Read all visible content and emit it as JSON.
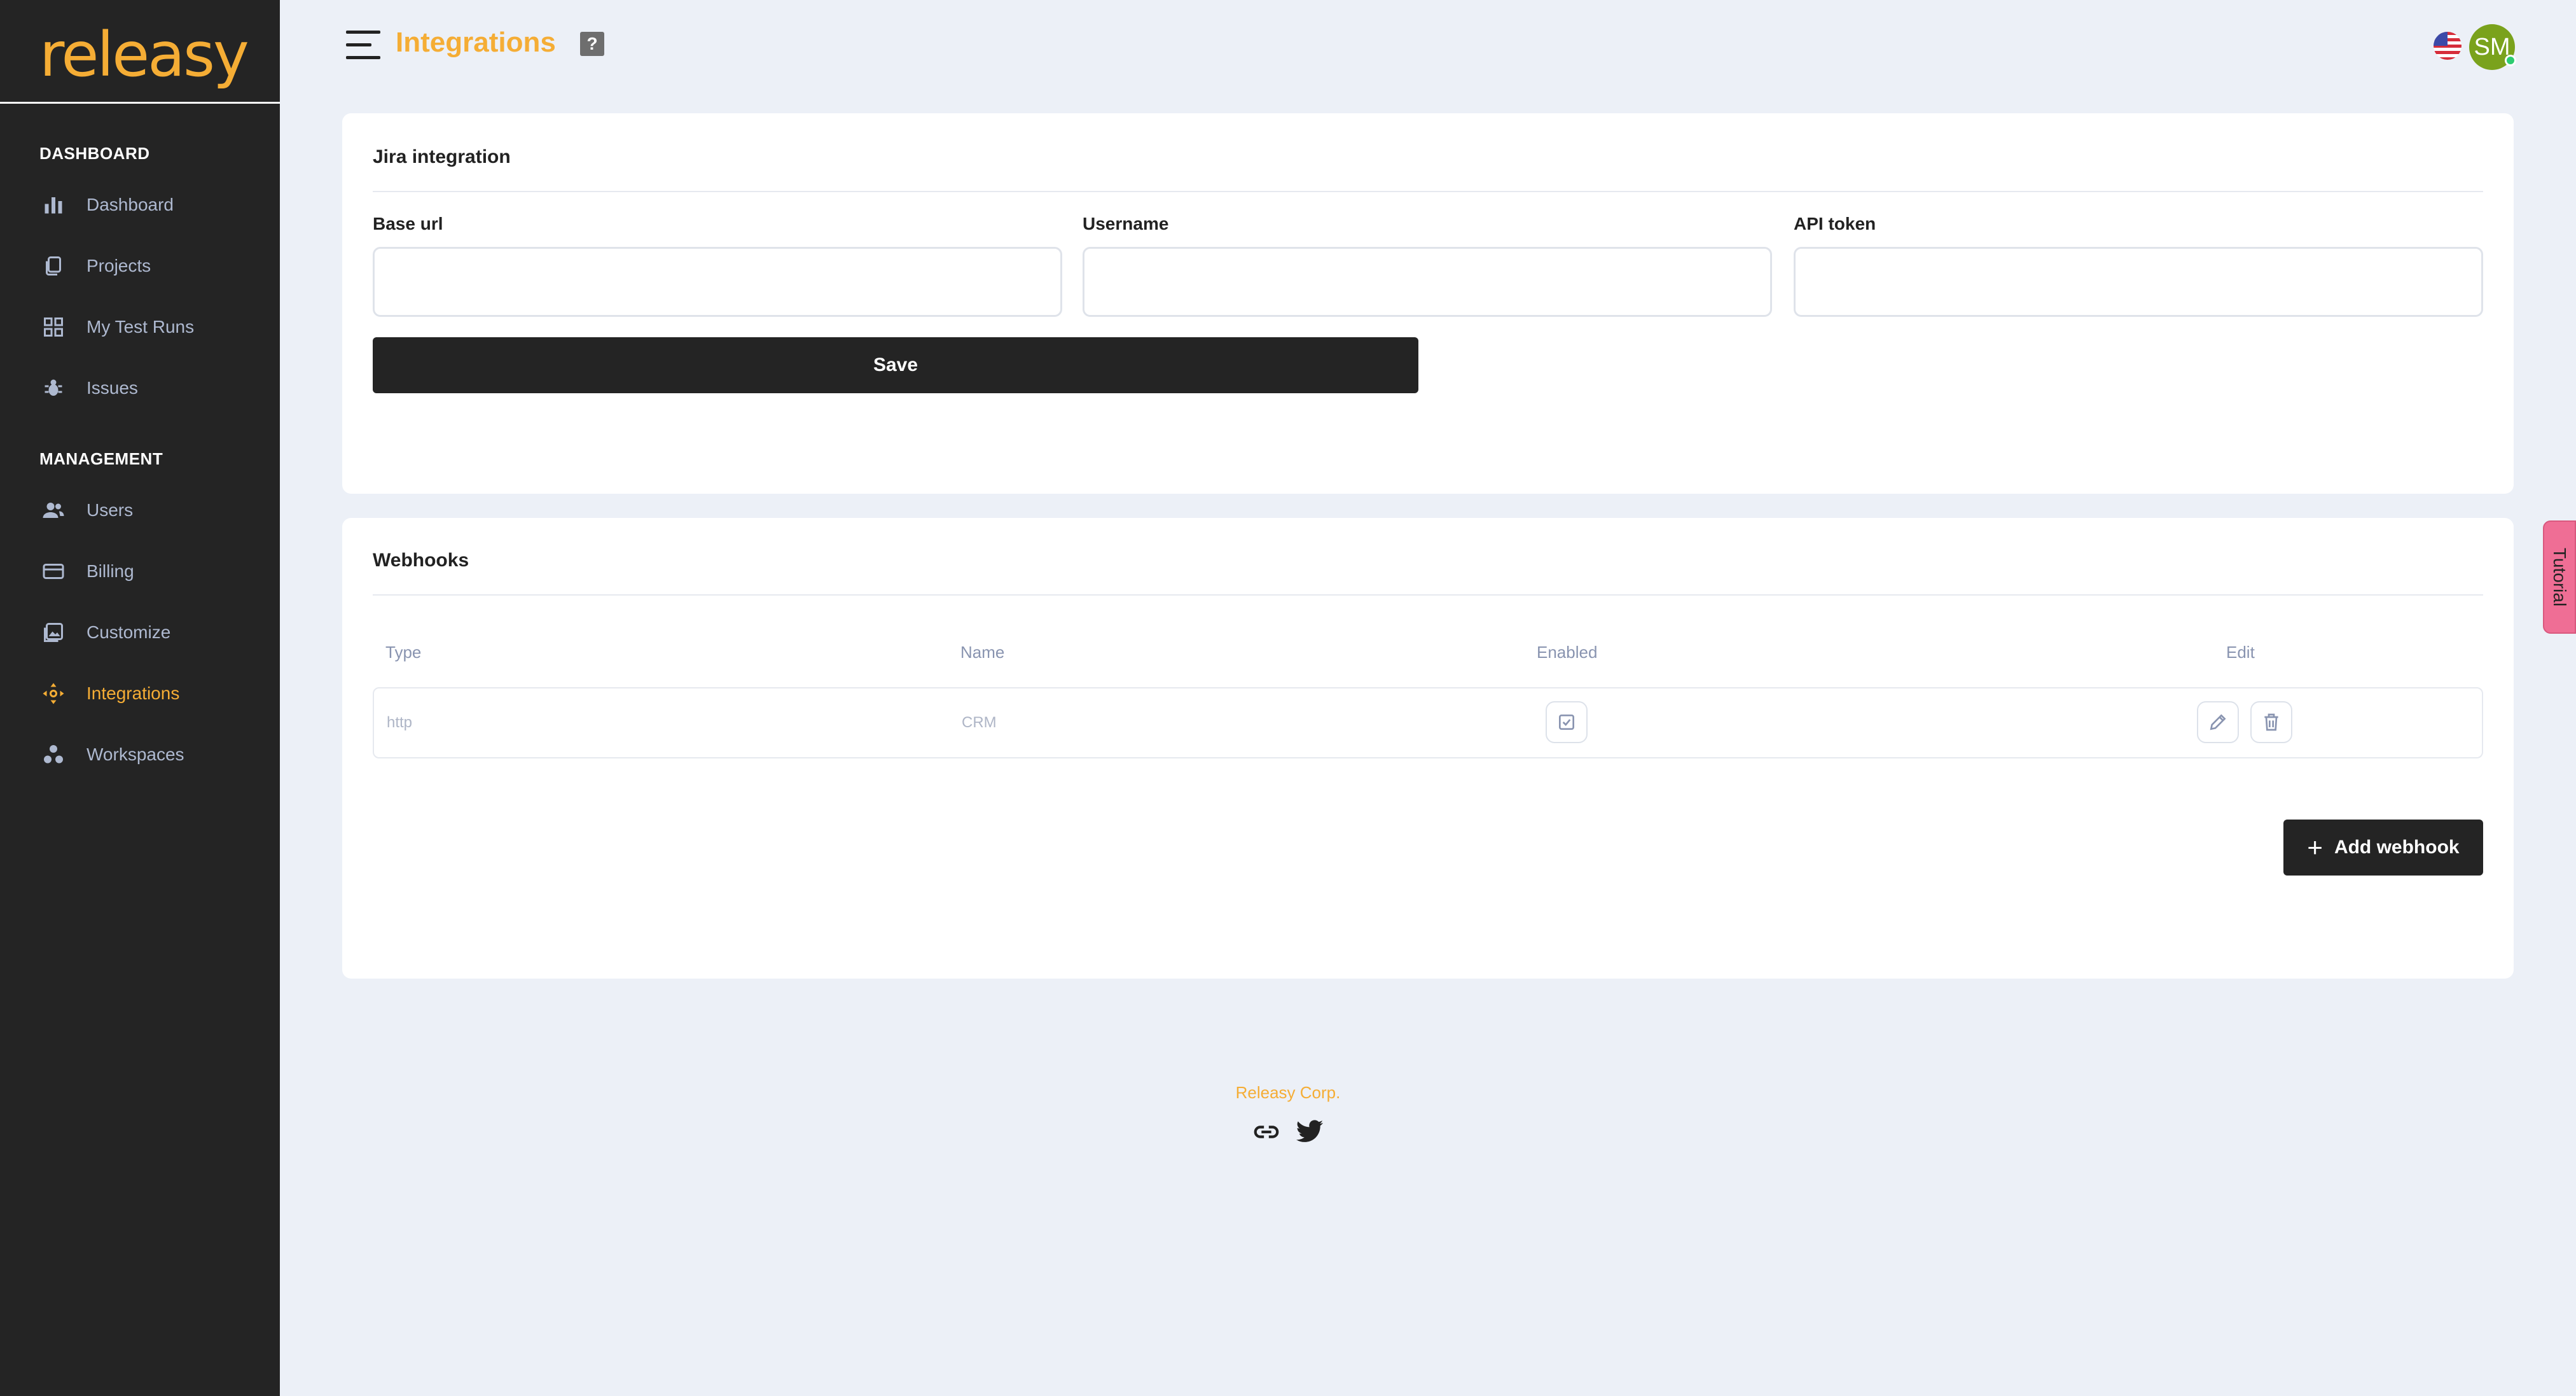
{
  "brand": {
    "logo_text": "releasy",
    "accent": "#f5ad35"
  },
  "sidebar": {
    "sections": [
      {
        "title": "DASHBOARD"
      },
      {
        "title": "MANAGEMENT"
      }
    ],
    "items": [
      {
        "label": "Dashboard",
        "icon": "bar-chart-icon"
      },
      {
        "label": "Projects",
        "icon": "document-copy-icon"
      },
      {
        "label": "My Test Runs",
        "icon": "grid-icon"
      },
      {
        "label": "Issues",
        "icon": "bug-icon"
      },
      {
        "label": "Users",
        "icon": "users-icon"
      },
      {
        "label": "Billing",
        "icon": "credit-card-icon"
      },
      {
        "label": "Customize",
        "icon": "image-gallery-icon"
      },
      {
        "label": "Integrations",
        "icon": "integrations-icon",
        "active": true
      },
      {
        "label": "Workspaces",
        "icon": "workspaces-icon"
      }
    ]
  },
  "header": {
    "title": "Integrations",
    "help_label": "?",
    "avatar_initials": "SM",
    "flag_icon": "us-flag-icon"
  },
  "jira": {
    "title": "Jira integration",
    "fields": [
      {
        "label": "Base url",
        "value": "",
        "placeholder": ""
      },
      {
        "label": "Username",
        "value": "",
        "placeholder": ""
      },
      {
        "label": "API token",
        "value": "",
        "placeholder": ""
      }
    ],
    "save_label": "Save"
  },
  "webhooks": {
    "title": "Webhooks",
    "columns": [
      "Type",
      "Name",
      "Enabled",
      "Edit"
    ],
    "rows": [
      {
        "type": "http",
        "name": "CRM",
        "enabled": true
      }
    ],
    "add_label": "Add webhook"
  },
  "footer": {
    "company": "Releasy Corp.",
    "icons": [
      "link-icon",
      "twitter-icon"
    ]
  },
  "tutorial": {
    "label": "Tutorial"
  }
}
